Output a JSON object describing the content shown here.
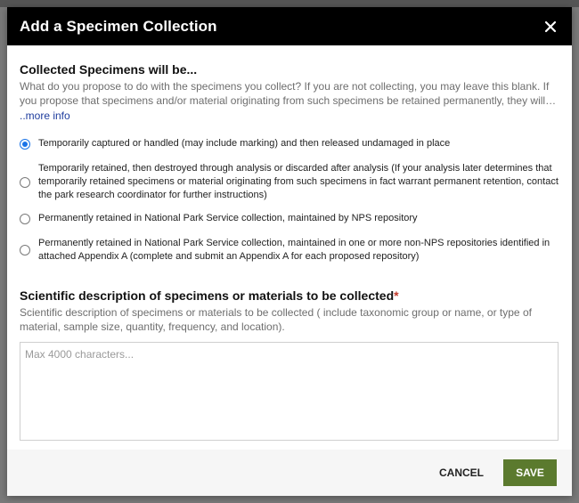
{
  "modal": {
    "title": "Add a Specimen Collection",
    "close_icon": "close-icon"
  },
  "collected_section": {
    "heading": "Collected Specimens will be...",
    "description": "What do you propose to do with the specimens you collect? If you are not collecting, you may leave this blank. If you propose that specimens and/or material originating from such specimens be retained permanently, they will…",
    "more_link": "..more info",
    "options": [
      {
        "label": "Temporarily captured or handled (may include marking) and then released undamaged in place",
        "checked": true
      },
      {
        "label": "Temporarily retained, then destroyed through analysis or discarded after analysis (If your analysis later determines that temporarily retained specimens or material originating from such specimens in fact warrant permanent retention, contact the park research coordinator for further instructions)",
        "checked": false
      },
      {
        "label": "Permanently retained in National Park Service collection, maintained by NPS repository",
        "checked": false
      },
      {
        "label": "Permanently retained in National Park Service collection, maintained in one or more non-NPS repositories identified in attached Appendix A (complete and submit an Appendix A for each proposed repository)",
        "checked": false
      }
    ]
  },
  "scientific_section": {
    "heading": "Scientific description of specimens or materials to be collected",
    "required_mark": "*",
    "description": "Scientific description of specimens or materials to be collected ( include taxonomic group or name, or type of material, sample size, quantity, frequency, and location).",
    "textarea_value": "",
    "textarea_placeholder": "Max 4000 characters..."
  },
  "footer": {
    "cancel_label": "CANCEL",
    "save_label": "SAVE"
  },
  "colors": {
    "header_bg": "#000000",
    "save_bg": "#5b7a2e",
    "link": "#1f3d9e",
    "radio_selected": "#1a73e8",
    "required": "#c0392b"
  }
}
